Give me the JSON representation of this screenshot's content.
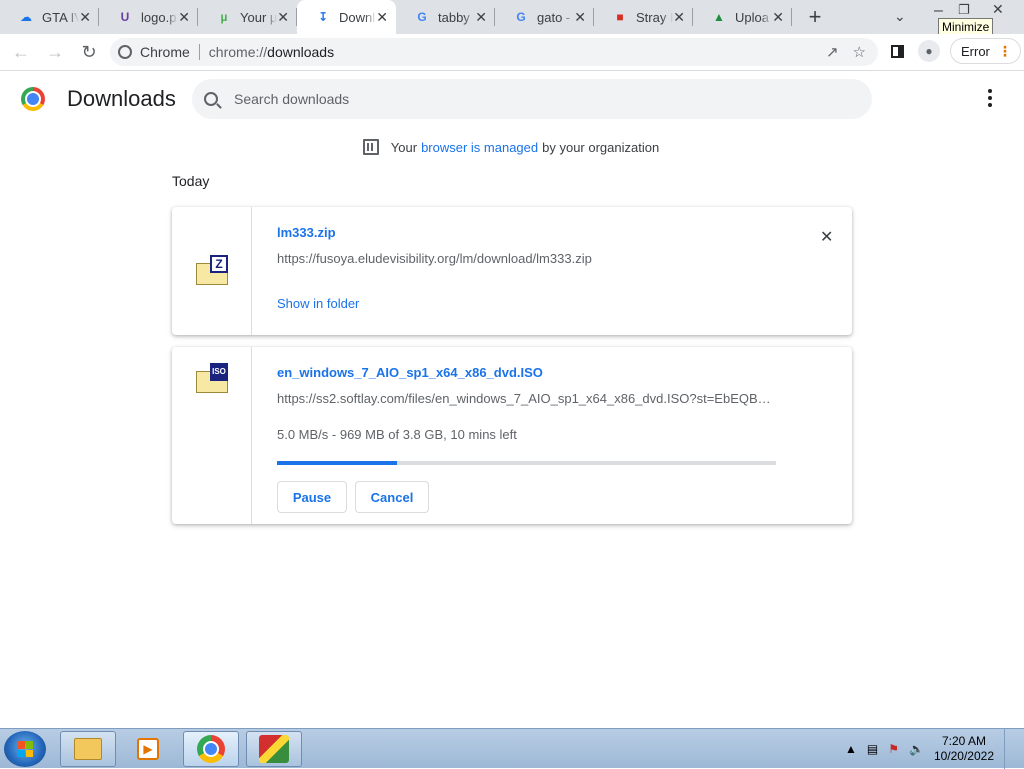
{
  "tabs": [
    {
      "title": "GTA IV",
      "icon": "onedrive-cloud-icon",
      "icon_color": "#1a73e8",
      "active": false
    },
    {
      "title": "logo.p",
      "icon": "u-letter-icon",
      "icon_color": "#6b3fa0",
      "active": false
    },
    {
      "title": "Your µ",
      "icon": "utorrent-icon",
      "icon_color": "#4caf50",
      "active": false
    },
    {
      "title": "Downl",
      "icon": "download-arrow-icon",
      "icon_color": "#1a73e8",
      "active": true
    },
    {
      "title": "tabby",
      "icon": "google-g-icon",
      "icon_color": "#4285f4",
      "active": false
    },
    {
      "title": "gato -",
      "icon": "google-g-icon",
      "icon_color": "#4285f4",
      "active": false
    },
    {
      "title": "Stray F",
      "icon": "red-gift-icon",
      "icon_color": "#d93025",
      "active": false
    },
    {
      "title": "Uploa",
      "icon": "green-upload-icon",
      "icon_color": "#1e8e3e",
      "active": false
    }
  ],
  "tooltip": "Minimize",
  "omnibox": {
    "chip": "Chrome",
    "url_scheme": "chrome://",
    "url_path": "downloads"
  },
  "toolbar": {
    "error_label": "Error"
  },
  "header": {
    "title": "Downloads",
    "search_placeholder": "Search downloads"
  },
  "managed": {
    "prefix": "Your",
    "link": "browser is managed",
    "suffix": "by your organization"
  },
  "section_label": "Today",
  "downloads": [
    {
      "filename": "lm333.zip",
      "url": "https://fusoya.eludevisibility.org/lm/download/lm333.zip",
      "action_link": "Show in folder",
      "badge": "Z"
    },
    {
      "filename": "en_windows_7_AIO_sp1_x64_x86_dvd.ISO",
      "url": "https://ss2.softlay.com/files/en_windows_7_AIO_sp1_x64_x86_dvd.ISO?st=EbEQBZK...",
      "status": "5.0 MB/s - 969 MB of 3.8 GB, 10 mins left",
      "progress_fraction": 0.24,
      "pause_label": "Pause",
      "cancel_label": "Cancel",
      "badge": "ISO"
    }
  ],
  "taskbar": {
    "time": "7:20 AM",
    "date": "10/20/2022"
  },
  "colors": {
    "accent": "#1a73e8",
    "tabbar_bg": "#dee1e6",
    "taskbar_bg": "#b8cde4"
  }
}
